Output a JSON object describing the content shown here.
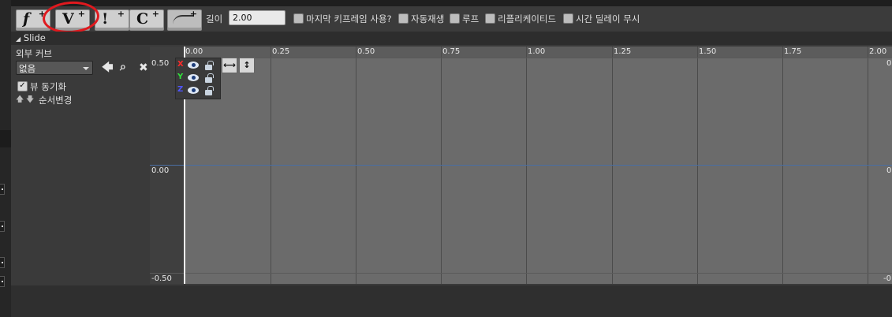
{
  "toolbar": {
    "buttons": [
      {
        "name": "f",
        "label": "f"
      },
      {
        "name": "v",
        "label": "V"
      },
      {
        "name": "bool",
        "label": "!"
      },
      {
        "name": "c",
        "label": "C"
      },
      {
        "name": "curve",
        "label": ""
      }
    ],
    "plus": "+",
    "length_label": "길이",
    "length_value": "2.00",
    "checks": [
      {
        "label": "마지막 키프레임 사용?",
        "checked": false
      },
      {
        "label": "자동재생",
        "checked": false
      },
      {
        "label": "루프",
        "checked": false
      },
      {
        "label": "리플리케이티드",
        "checked": false
      },
      {
        "label": "시간 딜레이 무시",
        "checked": false
      }
    ]
  },
  "track": {
    "name": "Slide",
    "collapse_glyph": "◢"
  },
  "panel": {
    "external_curve_label": "외부 커브",
    "curve_select_value": "없음",
    "sync_view_label": "뷰 동기화",
    "sync_view_checked": true,
    "check_mark": "✓",
    "reorder_label": "순서변경",
    "up_arrow": "🡅",
    "down_arrow": "🡇",
    "back_icon": "🡄",
    "search_icon": "⌕",
    "clear_icon": "✖"
  },
  "graph": {
    "x_ticks": [
      "0.00",
      "0.25",
      "0.50",
      "0.75",
      "1.00",
      "1.25",
      "1.50",
      "1.75",
      "2.00"
    ],
    "y_labels": {
      "top": "0.50",
      "mid": "0.00",
      "bottom": "-0.50"
    },
    "right_labels": {
      "top": "0",
      "mid": "0",
      "bottom": "-0"
    },
    "channels": [
      {
        "label": "X",
        "color": "#ff2a2a"
      },
      {
        "label": "Y",
        "color": "#31e03a"
      },
      {
        "label": "Z",
        "color": "#4f55ff"
      }
    ],
    "fit_horizontal": "⟷",
    "fit_vertical": "↕"
  }
}
